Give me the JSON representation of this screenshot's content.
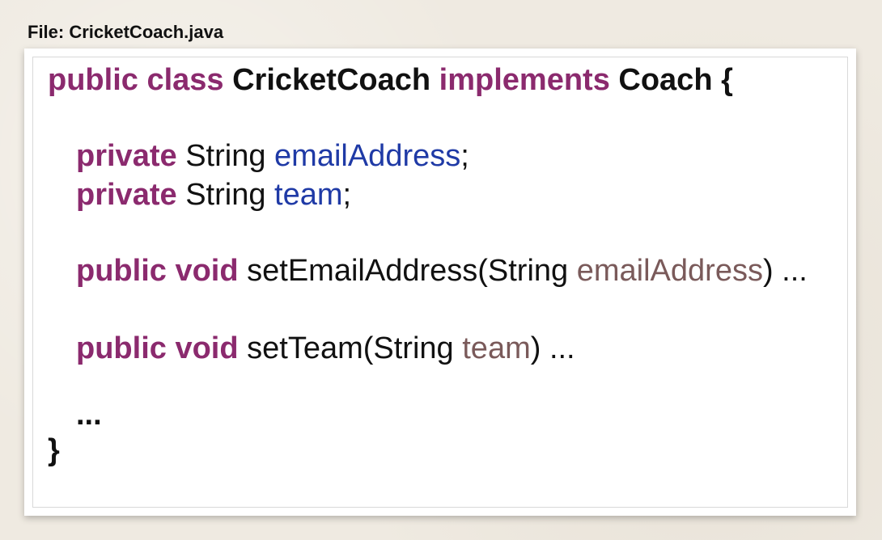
{
  "file_label": "File: CricketCoach.java",
  "code": {
    "line1": {
      "kw_public": "public",
      "kw_class": "class",
      "class_name": "CricketCoach",
      "kw_implements": "implements",
      "iface": "Coach",
      "brace": "{"
    },
    "line2": {
      "kw_private": "private",
      "type": "String",
      "field": "emailAddress",
      "semicolon": ";"
    },
    "line3": {
      "kw_private": "private",
      "type": "String",
      "field": "team",
      "semicolon": ";"
    },
    "line4": {
      "kw_public": "public",
      "kw_void": "void",
      "method": "setEmailAddress(String",
      "param": "emailAddress",
      "tail": ") ..."
    },
    "line5": {
      "kw_public": "public",
      "kw_void": "void",
      "method": "setTeam(String",
      "param": "team",
      "tail": ") ..."
    },
    "line6": {
      "ellipsis": "..."
    },
    "line7": {
      "brace": "}"
    }
  }
}
